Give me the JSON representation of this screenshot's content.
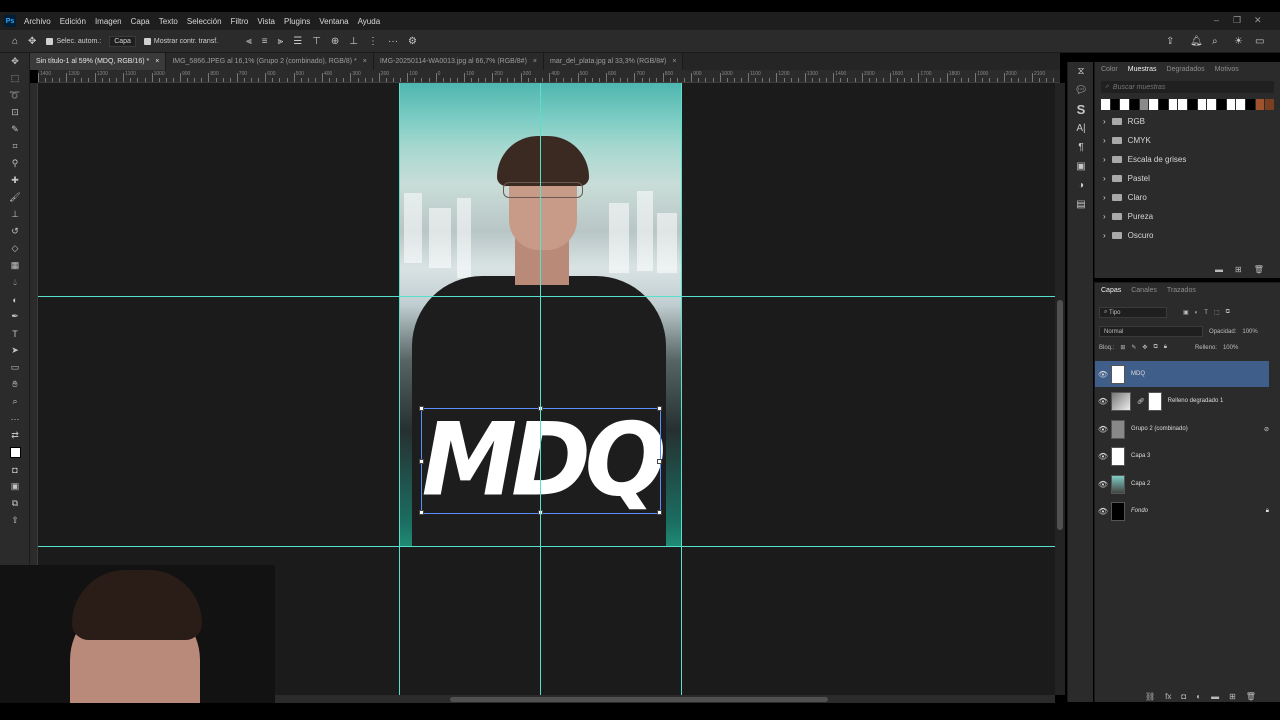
{
  "app": {
    "logo": "Ps"
  },
  "menu": [
    "Archivo",
    "Edición",
    "Imagen",
    "Capa",
    "Texto",
    "Selección",
    "Filtro",
    "Vista",
    "Plugins",
    "Ventana",
    "Ayuda"
  ],
  "options": {
    "auto_select_label": "Selec. autom.:",
    "auto_select_target": "Capa",
    "show_transform_label": "Mostrar contr. transf."
  },
  "tabs": [
    {
      "label": "Sin título-1 al 59% (MDQ, RGB/16) *",
      "active": true
    },
    {
      "label": "IMG_5866.JPEG al 16,1% (Grupo 2 (combinado), RGB/8) *",
      "active": false
    },
    {
      "label": "IMG-20250114-WA0013.jpg al 66,7% (RGB/8#)",
      "active": false
    },
    {
      "label": "mar_del_plata.jpg al 33,3% (RGB/8#)",
      "active": false
    }
  ],
  "ruler_labels": [
    "1400",
    "1300",
    "1200",
    "1100",
    "1000",
    "900",
    "800",
    "700",
    "600",
    "500",
    "400",
    "300",
    "200",
    "100",
    "0",
    "100",
    "200",
    "300",
    "400",
    "500",
    "600",
    "700",
    "800",
    "900",
    "1000",
    "1100",
    "1200",
    "1300",
    "1400",
    "1500",
    "1600",
    "1700",
    "1800",
    "1900",
    "2000",
    "2100"
  ],
  "canvas": {
    "text": "MDQ"
  },
  "color_panel": {
    "tabs": [
      "Color",
      "Muestras",
      "Degradados",
      "Motivos"
    ],
    "active_tab": "Muestras",
    "search_placeholder": "Buscar muestras",
    "swatches": [
      "#ffffff",
      "#000000",
      "#ffffff",
      "#000000",
      "#8a8a8a",
      "#ffffff",
      "#000000",
      "#ffffff",
      "#ffffff",
      "#000000",
      "#ffffff",
      "#ffffff",
      "#000000",
      "#ffffff",
      "#ffffff",
      "#000000",
      "#a0522d",
      "#7a3f20"
    ],
    "folders": [
      "RGB",
      "CMYK",
      "Escala de grises",
      "Pastel",
      "Claro",
      "Pureza",
      "Oscuro"
    ]
  },
  "layers_panel": {
    "tabs": [
      "Capas",
      "Canales",
      "Trazados"
    ],
    "active_tab": "Capas",
    "filter_label": "Tipo",
    "blend_mode": "Normal",
    "opacity_label": "Opacidad:",
    "opacity_value": "100%",
    "lock_label": "Bloq.:",
    "fill_label": "Relleno:",
    "fill_value": "100%",
    "layers": [
      {
        "name": "MDQ",
        "selected": true
      },
      {
        "name": "Relleno degradado 1",
        "selected": false
      },
      {
        "name": "Grupo 2 (combinado)",
        "selected": false
      },
      {
        "name": "Capa 3",
        "selected": false
      },
      {
        "name": "Capa 2",
        "selected": false
      },
      {
        "name": "Fondo",
        "selected": false
      }
    ]
  }
}
